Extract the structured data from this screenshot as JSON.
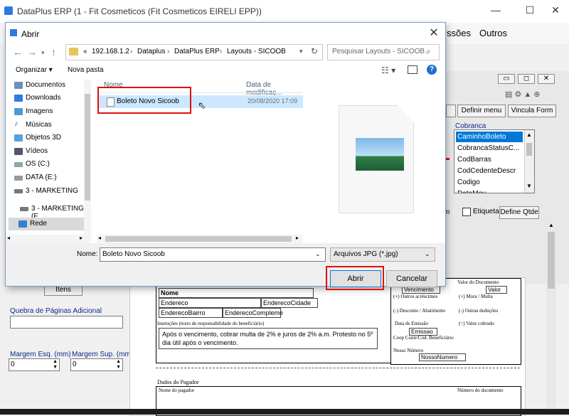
{
  "app": {
    "title": "DataPlus ERP (1 - Fit Cosmeticos  (Fit Cosmeticos EIRELI EPP))",
    "menu": [
      "ssões",
      "Outros"
    ]
  },
  "designer": {
    "buttons": [
      "Definir menu",
      "Vincula Form"
    ],
    "group_label": "Cobranca",
    "fields": [
      "CaminhoBoleto",
      "CobrancaStatusC...",
      "CodBarras",
      "CodCedenteDescr",
      "Codigo",
      "DataMov..."
    ],
    "selected_field": "CaminhoBoleto",
    "etiqueta_label": "Etiqueta",
    "define_qtde": "Define Qtde"
  },
  "left_panel": {
    "itens_button": "Itens",
    "page_break_label": "Quebra de Páginas Adicional",
    "margin_left_label": "Margem Esq. (mm)",
    "margin_top_label": "Margem Sup. (mm)",
    "margin_left_value": "0",
    "margin_top_value": "0"
  },
  "report": {
    "nome": "Nome",
    "endereco": "Endereco",
    "endereco_cidade": "EnderecoCidade",
    "endereco_bairro": "EnderecoBairro",
    "endereco_complemento": "EnderecoCompleme",
    "instrucoes_label": "Instruções (texto de responsabilidade do beneficiário)",
    "instrucoes_text": "Após o vencimento, cobrar multa de 2% e juros de 2% a.m. Protesto no 5º dia útil após o vencimento.",
    "vencimento": "Vencimento",
    "valor_documento": "Valor do Documento",
    "valor": "Valor",
    "outros_acrescimos": "(+) Outros acréscimos",
    "mora_multa": "(+) Mora / Multa",
    "desconto": "(-) Desconto / Abatimento",
    "outras_deducoes": "(-) Outras deduções",
    "data_emissao": "Data de Emissão",
    "emissao": "Emissao",
    "valor_cobrado": "(=) Valor cobrado",
    "coop_contr": "Coop Contr/Cód. Beneficiário",
    "nosso_numero_label": "Nosso Número",
    "nosso_numero": "NossoNumero",
    "dados_pagador": "Dados do Pagador",
    "nome_pagador": "Nome do pagador",
    "numero_documento": "Número do documento"
  },
  "dialog": {
    "title": "Abrir",
    "breadcrumb": [
      "«",
      "192.168.1.2",
      "Dataplus",
      "DataPlus ERP",
      "Layouts - SICOOB"
    ],
    "search_placeholder": "Pesquisar Layouts - SICOOB",
    "organize": "Organizar ▾",
    "new_folder": "Nova pasta",
    "nav_items": [
      {
        "label": "Documentos",
        "icon": "documents-icon"
      },
      {
        "label": "Downloads",
        "icon": "downloads-icon"
      },
      {
        "label": "Imagens",
        "icon": "pictures-icon"
      },
      {
        "label": "Músicas",
        "icon": "music-icon"
      },
      {
        "label": "Objetos 3D",
        "icon": "objects3d-icon"
      },
      {
        "label": "Vídeos",
        "icon": "videos-icon"
      },
      {
        "label": "OS (C:)",
        "icon": "drive-icon"
      },
      {
        "label": "DATA (E:)",
        "icon": "drive-icon"
      },
      {
        "label": "3 - MARKETING",
        "icon": "network-drive-icon"
      },
      {
        "label": "3 - MARKETING (F",
        "icon": "network-drive-icon"
      },
      {
        "label": "Rede",
        "icon": "network-icon"
      }
    ],
    "columns": [
      "Nome",
      "Data de modificaç..."
    ],
    "files": [
      {
        "name": "Boleto Novo Sicoob",
        "modified": "20/08/2020 17:09"
      }
    ],
    "filename_label": "Nome:",
    "filename_value": "Boleto Novo Sicoob",
    "filetype": "Arquivos JPG (*.jpg)",
    "open": "Abrir",
    "cancel": "Cancelar"
  },
  "colors": {
    "highlight_red": "#e01010",
    "selection_blue": "#cce8ff",
    "link_blue": "#0a2a8c"
  }
}
